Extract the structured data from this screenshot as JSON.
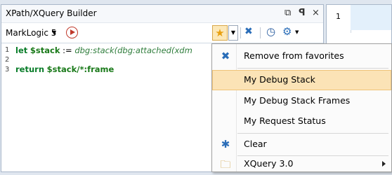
{
  "panel": {
    "title": "XPath/XQuery Builder",
    "title_buttons": {
      "restore": "⧉",
      "pin": "ꟼ",
      "close": "×"
    }
  },
  "toolbar": {
    "database": "MarkLogic 5",
    "run_icon": "play-icon",
    "favorites_icon": "star-icon",
    "clear_icon": "x-icon",
    "history_icon": "clock-icon",
    "options_icon": "gear-icon"
  },
  "editor": {
    "lines": [
      {
        "number": "1",
        "kw": "let",
        "var": "$stack",
        "op": " := ",
        "fn": "dbg:stack(dbg:attached(xdm"
      },
      {
        "number": "2"
      },
      {
        "number": "3",
        "kw": "return",
        "var": "$stack",
        "rest": "/*:frame"
      }
    ]
  },
  "right_panel": {
    "line_number": "1"
  },
  "menu": {
    "items": [
      {
        "label": "Remove from favorites",
        "icon": "remove-favorite-icon",
        "highlighted": false
      },
      {
        "label": "My Debug Stack",
        "icon": "",
        "highlighted": true
      },
      {
        "label": "My Debug Stack Frames",
        "icon": "",
        "highlighted": false
      },
      {
        "label": "My Request Status",
        "icon": "",
        "highlighted": false
      },
      {
        "label": "Clear",
        "icon": "clear-icon",
        "highlighted": false
      },
      {
        "label": "XQuery 3.0",
        "icon": "folder-icon",
        "highlighted": false,
        "submenu": true
      }
    ]
  },
  "colors": {
    "highlight": "#fbe3b6",
    "accent": "#2a6db8",
    "run": "#c0392b",
    "code_green": "#0a7d2a"
  }
}
